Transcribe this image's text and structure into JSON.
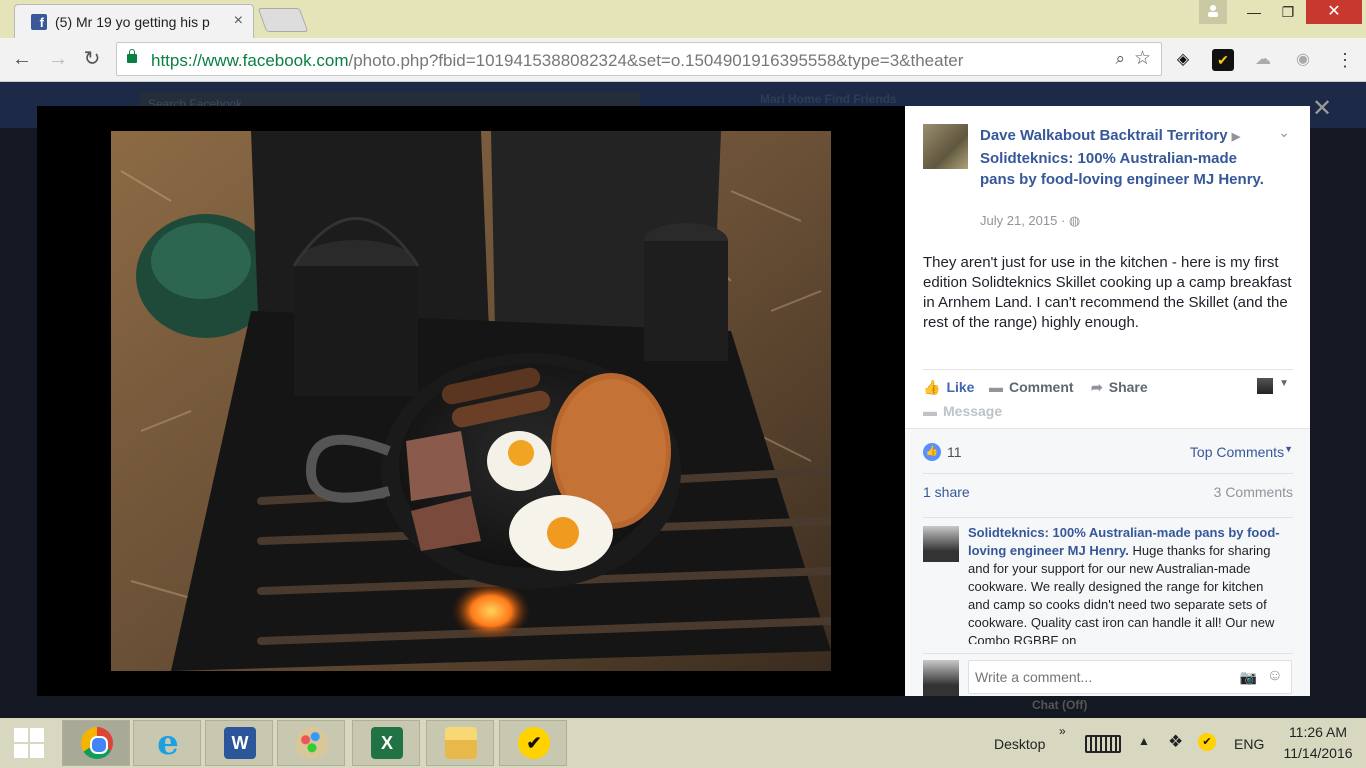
{
  "browser": {
    "tab_title": "(5) Mr 19 yo getting his p",
    "tab_close": "×",
    "url_host": "https://www.facebook.com",
    "url_path": "/photo.php?fbid=1019415388082324&set=o.1504901916395558&type=3&theater",
    "window_min": "—",
    "window_max": "❐",
    "window_close": "✕"
  },
  "fb_background": {
    "search_placeholder": "Search Facebook",
    "nav_text": "Mari    Home    Find Friends",
    "chat_status": "Chat (Off)"
  },
  "post": {
    "author": "Dave Walkabout Backtrail Territory",
    "tagged_page": "Solidteknics: 100% Australian-made pans by food-loving engineer MJ Henry.",
    "date": "July 21, 2015",
    "privacy_icon": "globe-icon",
    "text": "They aren't just for use in the kitchen - here is my first edition Solidteknics Skillet cooking up a camp breakfast in Arnhem Land. I can't recommend the Skillet (and the rest of the range) highly enough."
  },
  "actions": {
    "like": "Like",
    "comment": "Comment",
    "share": "Share",
    "message": "Message"
  },
  "ufi": {
    "like_count": "11",
    "top_comments": "Top Comments",
    "shares": "1 share",
    "comments": "3 Comments",
    "write_placeholder": "Write a comment..."
  },
  "comment": {
    "author": "Solidteknics: 100% Australian-made pans by food-loving engineer MJ Henry.",
    "text": "Huge thanks for sharing and for your support for our new Australian-made cookware. We really designed the range for kitchen and camp so cooks didn't need two separate sets of cookware. Quality cast iron can handle it all! Our new Combo RGBBF on"
  },
  "taskbar": {
    "desktop": "Desktop",
    "desktop_chevron": "»",
    "language": "ENG",
    "time": "11:26 AM",
    "date": "11/14/2016",
    "apps": [
      "Chrome",
      "Internet Explorer",
      "Word",
      "Paint",
      "Excel",
      "File Explorer",
      "Norton"
    ]
  },
  "colors": {
    "facebook_blue": "#3b5998",
    "link_blue": "#365899",
    "taskbar": "#d8d8c0",
    "titlebar": "#e4e4b8"
  }
}
